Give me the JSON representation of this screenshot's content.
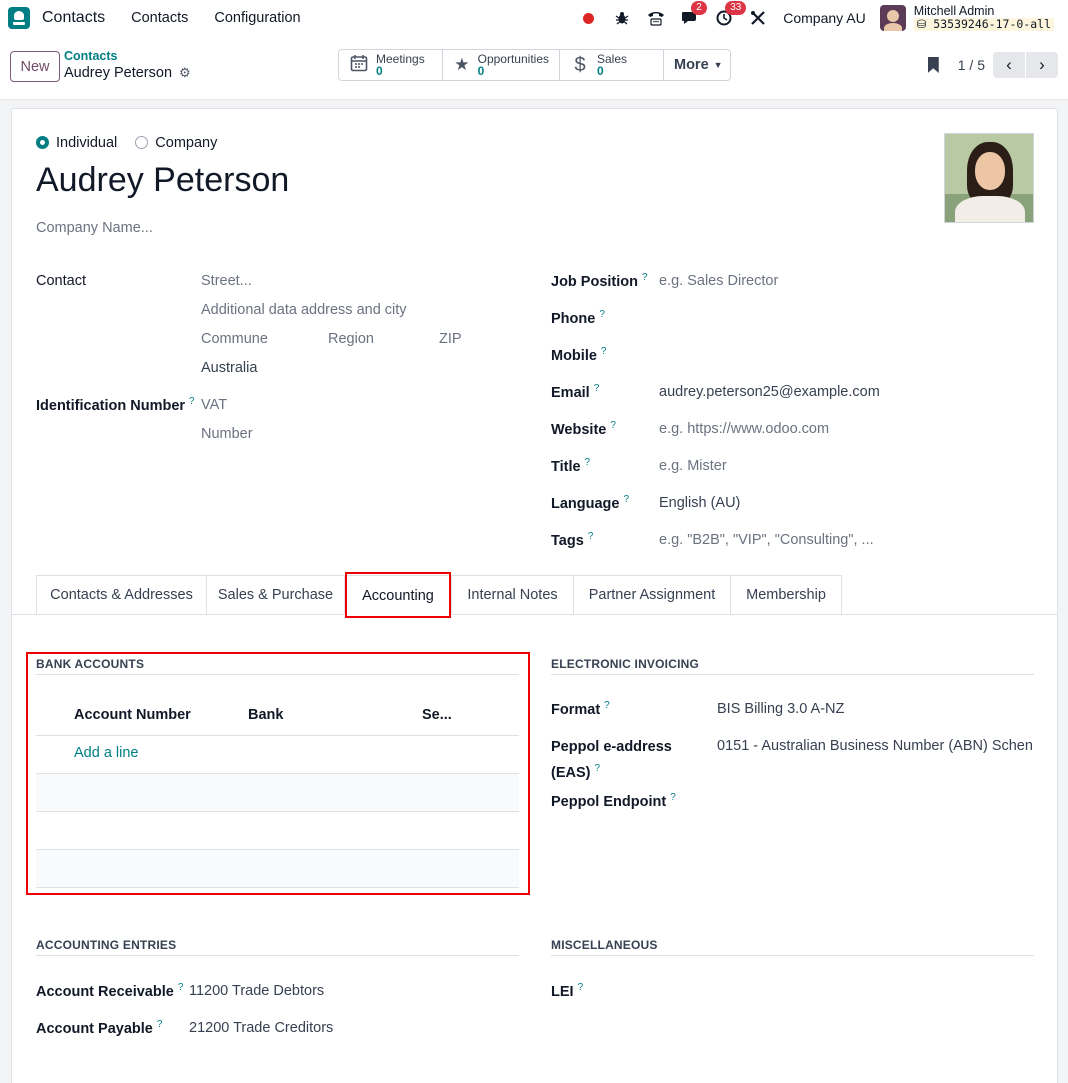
{
  "navbar": {
    "app_name": "Contacts",
    "menu": [
      "Contacts",
      "Configuration"
    ],
    "chat_badge": "2",
    "activity_badge": "33",
    "company": "Company AU",
    "user_name": "Mitchell Admin",
    "db": "53539246-17-0-all"
  },
  "control_panel": {
    "new_label": "New",
    "breadcrumb_parent": "Contacts",
    "breadcrumb_current": "Audrey Peterson",
    "smart_buttons": [
      {
        "label": "Meetings",
        "value": "0",
        "icon": "calendar-icon"
      },
      {
        "label": "Opportunities",
        "value": "0",
        "icon": "star-icon"
      },
      {
        "label": "Sales",
        "value": "0",
        "icon": "dollar-icon"
      }
    ],
    "more_label": "More",
    "pager": "1 / 5"
  },
  "form": {
    "type_options": [
      "Individual",
      "Company"
    ],
    "selected_type": "Individual",
    "name": "Audrey Peterson",
    "company_placeholder": "Company Name...",
    "contact_label": "Contact",
    "street_placeholder": "Street...",
    "additional_placeholder": "Additional data address and city",
    "commune_placeholder": "Commune",
    "region_placeholder": "Region",
    "zip_placeholder": "ZIP",
    "country": "Australia",
    "id_label": "Identification Number",
    "vat_placeholder": "VAT",
    "number_placeholder": "Number",
    "right_fields": [
      {
        "label": "Job Position",
        "value": "",
        "placeholder": "e.g. Sales Director"
      },
      {
        "label": "Phone",
        "value": "",
        "placeholder": ""
      },
      {
        "label": "Mobile",
        "value": "",
        "placeholder": ""
      },
      {
        "label": "Email",
        "value": "audrey.peterson25@example.com",
        "placeholder": ""
      },
      {
        "label": "Website",
        "value": "",
        "placeholder": "e.g. https://www.odoo.com"
      },
      {
        "label": "Title",
        "value": "",
        "placeholder": "e.g. Mister"
      },
      {
        "label": "Language",
        "value": "English (AU)",
        "placeholder": ""
      },
      {
        "label": "Tags",
        "value": "",
        "placeholder": "e.g. \"B2B\", \"VIP\", \"Consulting\", ..."
      }
    ]
  },
  "tabs": [
    "Contacts & Addresses",
    "Sales & Purchase",
    "Accounting",
    "Internal Notes",
    "Partner Assignment",
    "Membership"
  ],
  "active_tab": "Accounting",
  "bank_accounts": {
    "title": "BANK ACCOUNTS",
    "columns": [
      "Account Number",
      "Bank",
      "Se..."
    ],
    "add_line": "Add a line"
  },
  "electronic_invoicing": {
    "title": "ELECTRONIC INVOICING",
    "format_label": "Format",
    "format_value": "BIS Billing 3.0 A-NZ",
    "eas_label_1": "Peppol e-address",
    "eas_label_2": "(EAS)",
    "eas_value": "0151 - Australian Business Number (ABN) Schen",
    "endpoint_label": "Peppol Endpoint"
  },
  "accounting_entries": {
    "title": "ACCOUNTING ENTRIES",
    "receivable_label": "Account Receivable",
    "receivable_value": "11200 Trade Debtors",
    "payable_label": "Account Payable",
    "payable_value": "21200 Trade Creditors"
  },
  "miscellaneous": {
    "title": "MISCELLANEOUS",
    "lei_label": "LEI"
  },
  "colors": {
    "brand": "#714b67",
    "accent": "#017e84",
    "highlight": "#ee0000"
  }
}
